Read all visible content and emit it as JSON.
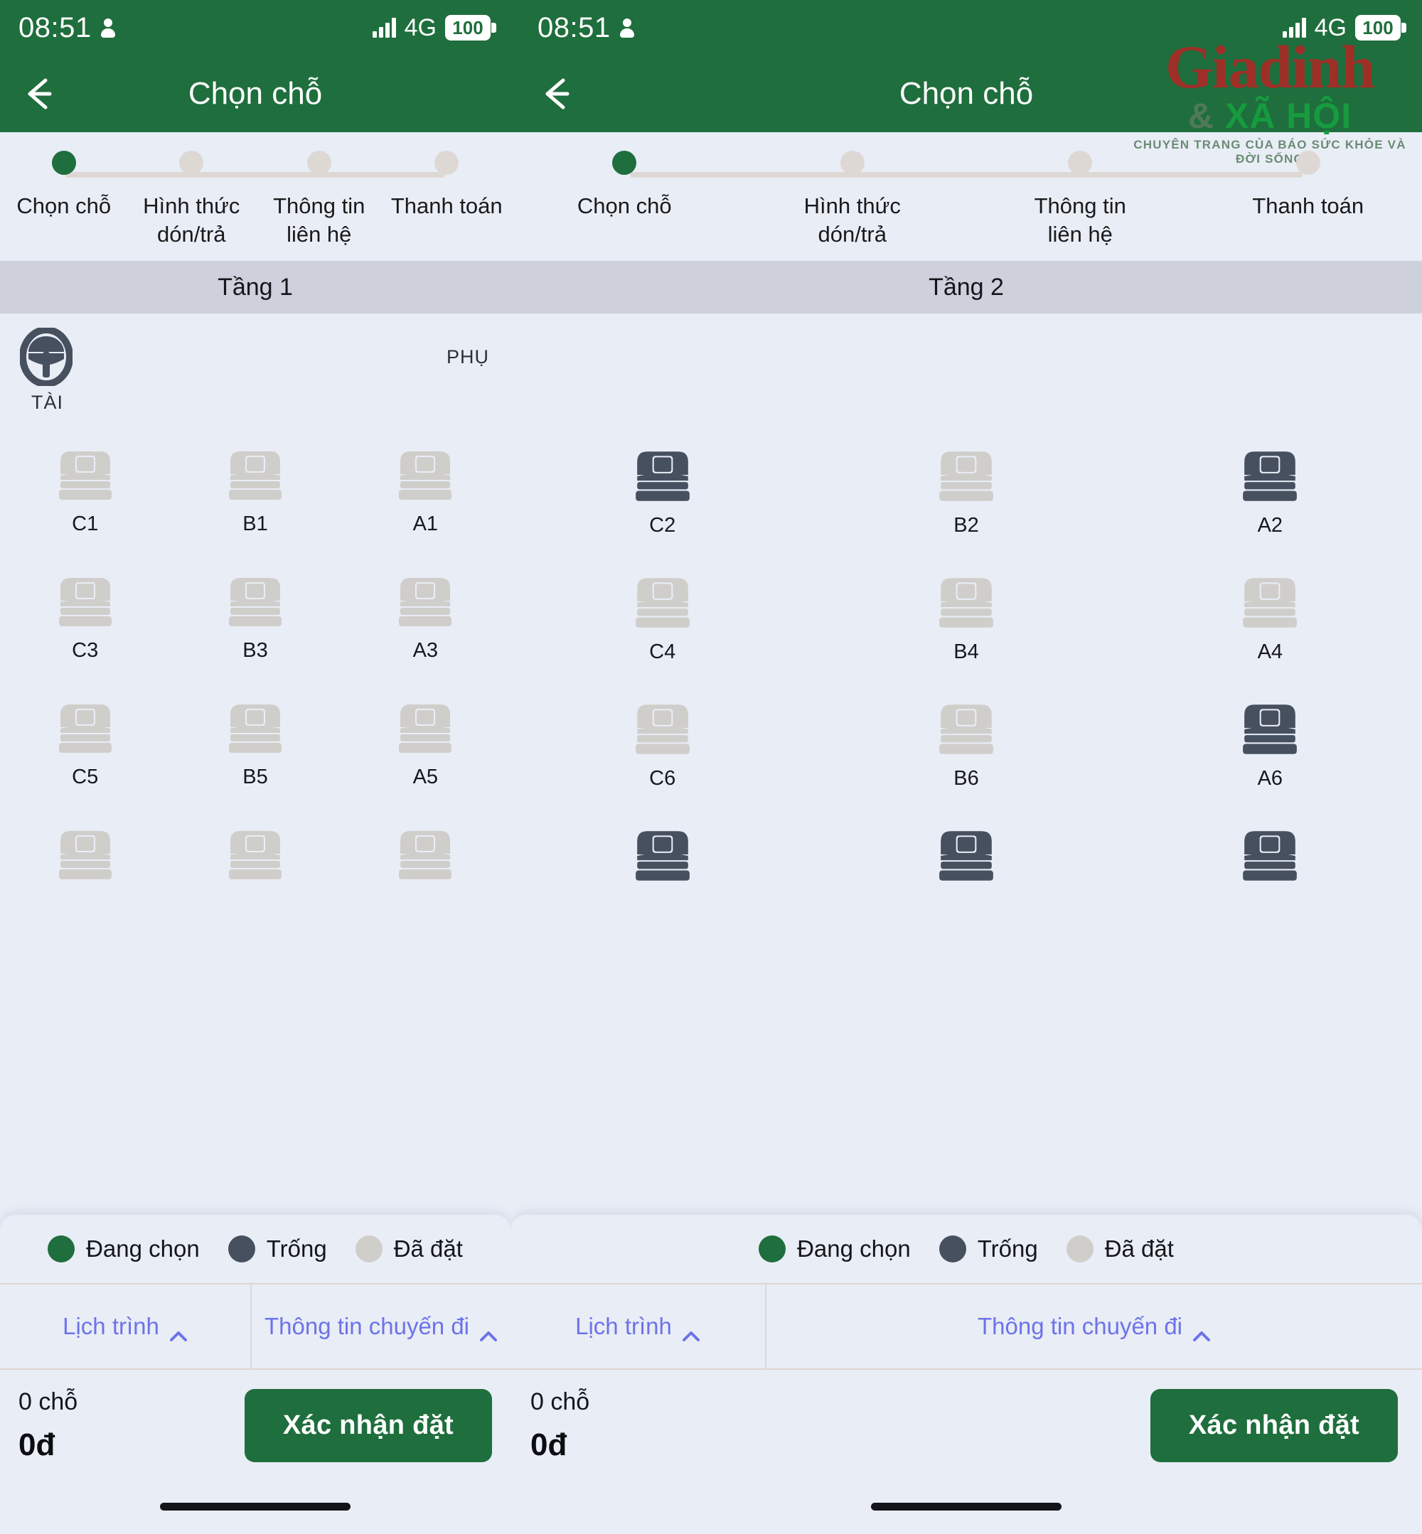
{
  "statusbar": {
    "time": "08:51",
    "network": "4G",
    "battery": "100",
    "person_icon": "person-icon",
    "signal_icon": "signal-bars-icon",
    "battery_icon": "battery-icon"
  },
  "appbar": {
    "title": "Chọn chỗ",
    "back_icon": "arrow-left-icon"
  },
  "stepper": {
    "steps": [
      {
        "label": "Chọn chỗ",
        "active": true
      },
      {
        "label": "Hình thức\ndón/trả",
        "active": false
      },
      {
        "label": "Thông tin\nliên hệ",
        "active": false
      },
      {
        "label": "Thanh toán",
        "active": false
      }
    ]
  },
  "left_panel": {
    "floor_label": "Tầng 1",
    "driver_label": "TÀI",
    "assistant_label": "PHỤ",
    "driver_icon": "steering-wheel-icon",
    "rows": [
      [
        {
          "label": "C1",
          "state": "booked"
        },
        {
          "label": "B1",
          "state": "booked"
        },
        {
          "label": "A1",
          "state": "booked"
        }
      ],
      [
        {
          "label": "C3",
          "state": "booked"
        },
        {
          "label": "B3",
          "state": "booked"
        },
        {
          "label": "A3",
          "state": "booked"
        }
      ],
      [
        {
          "label": "C5",
          "state": "booked"
        },
        {
          "label": "B5",
          "state": "booked"
        },
        {
          "label": "A5",
          "state": "booked"
        }
      ],
      [
        {
          "label": "",
          "state": "booked"
        },
        {
          "label": "",
          "state": "booked"
        },
        {
          "label": "",
          "state": "booked"
        }
      ]
    ]
  },
  "right_panel": {
    "floor_label": "Tầng 2",
    "assistant_label": "",
    "rows": [
      [
        {
          "label": "C2",
          "state": "empty"
        },
        {
          "label": "B2",
          "state": "booked"
        },
        {
          "label": "A2",
          "state": "empty"
        }
      ],
      [
        {
          "label": "C4",
          "state": "booked"
        },
        {
          "label": "B4",
          "state": "booked"
        },
        {
          "label": "A4",
          "state": "booked"
        }
      ],
      [
        {
          "label": "C6",
          "state": "booked"
        },
        {
          "label": "B6",
          "state": "booked"
        },
        {
          "label": "A6",
          "state": "empty"
        }
      ],
      [
        {
          "label": "",
          "state": "empty"
        },
        {
          "label": "",
          "state": "empty"
        },
        {
          "label": "",
          "state": "empty"
        }
      ]
    ]
  },
  "legend": [
    {
      "label": "Đang chọn",
      "color": "#1f6e3d"
    },
    {
      "label": "Trống",
      "color": "#47505f"
    },
    {
      "label": "Đã đặt",
      "color": "#d0cecb"
    }
  ],
  "accordion": {
    "schedule_label": "Lịch trình",
    "trip_info_label": "Thông tin chuyến đi",
    "chevron_icon": "chevron-up-icon"
  },
  "bottombar": {
    "seat_count": "0 chỗ",
    "price": "0đ",
    "confirm_label": "Xác nhận đặt"
  },
  "watermark": {
    "main": "Giadinh",
    "amp": "&",
    "sub": "XÃ HỘI",
    "tagline": "CHUYÊN TRANG CỦA BÁO SỨC KHỎE VÀ ĐỜI SỐNG"
  },
  "colors": {
    "brand_green": "#1f6e3d",
    "page_bg": "#e9edf6",
    "floor_band": "#ced1dc",
    "seat_empty": "#47505f",
    "seat_booked": "#d0cecb",
    "link_purple": "#6c73e8"
  }
}
